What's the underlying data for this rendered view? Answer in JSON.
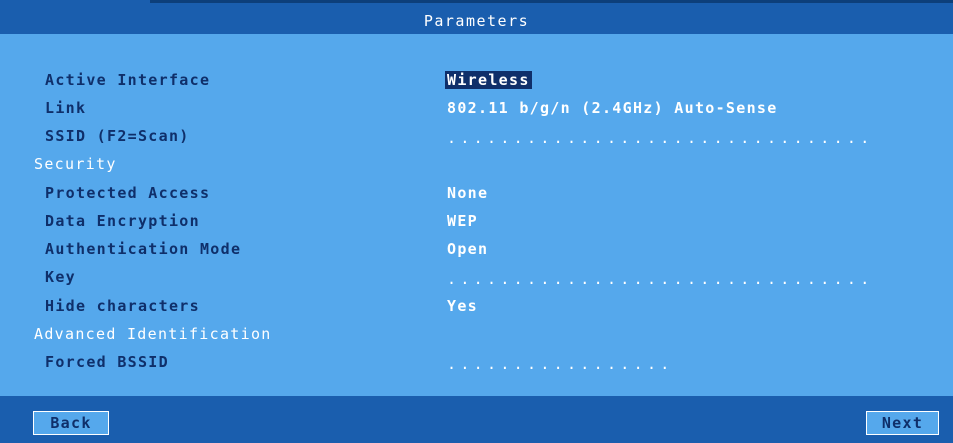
{
  "window": {
    "title": "Parameters"
  },
  "fields": [
    {
      "label": "Active Interface",
      "value": "Wireless"
    },
    {
      "label": "Link",
      "value": "802.11 b/g/n (2.4GHz) Auto-Sense"
    },
    {
      "label": "SSID (F2=Scan)",
      "value": "................................"
    },
    {
      "section": "Security"
    },
    {
      "label": "Protected Access",
      "value": "None"
    },
    {
      "label": "Data Encryption",
      "value": "WEP"
    },
    {
      "label": "Authentication Mode",
      "value": "Open"
    },
    {
      "label": "Key",
      "value": "................................"
    },
    {
      "label": "Hide characters",
      "value": "Yes"
    },
    {
      "section": "Advanced Identification"
    },
    {
      "label": "Forced BSSID",
      "value": "................."
    }
  ],
  "footer": {
    "back_label": "Back",
    "next_label": "Next"
  },
  "colors": {
    "panel": "#55a8ec",
    "titlebar": "#1a5eae",
    "label_text": "#0f2f6a",
    "value_text": "#ffffff"
  }
}
